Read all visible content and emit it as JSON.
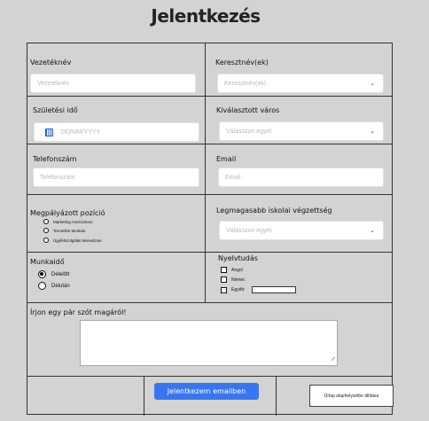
{
  "form": {
    "title": "Jelentkezés",
    "last_name": {
      "label": "Vezetéknév",
      "placeholder": "Vezetéknév"
    },
    "first_name": {
      "label": "Keresztnév(ek)",
      "placeholder": "Keresztnév(ek)",
      "icon": "chevron-down-icon"
    },
    "birth_date": {
      "label": "Születési idő",
      "placeholder": "DD/MM/YYYY",
      "icon": "calendar-icon"
    },
    "city": {
      "label": "Kiválasztott város",
      "placeholder": "Válasszon egyet",
      "icon": "chevron-down-icon"
    },
    "phone": {
      "label": "Telefonszám",
      "placeholder": "Telefonszám"
    },
    "email": {
      "label": "Email",
      "placeholder": "Email"
    },
    "position": {
      "label": "Megpályázott pozíció",
      "options": [
        "Marketing Asszisztens",
        "Termelési Munkás",
        "Ügyfélszolgálati Menedzser"
      ]
    },
    "education": {
      "label": "Legmagasabb iskolai végzettség",
      "placeholder": "Válasszon egyet",
      "icon": "chevron-down-icon"
    },
    "shift": {
      "label": "Munkaidő",
      "options": [
        "Délelőtt",
        "Délután"
      ],
      "selected": "Délelőtt"
    },
    "languages": {
      "label": "Nyelvtudás",
      "options": [
        "Angol",
        "Német",
        "Egyéb:"
      ]
    },
    "about": {
      "label": "Írjon egy pár szót magáról!"
    },
    "submit_label": "Jelentkezem emailben",
    "reset_label": "Űrlap alaphelyzetbe állítása"
  }
}
